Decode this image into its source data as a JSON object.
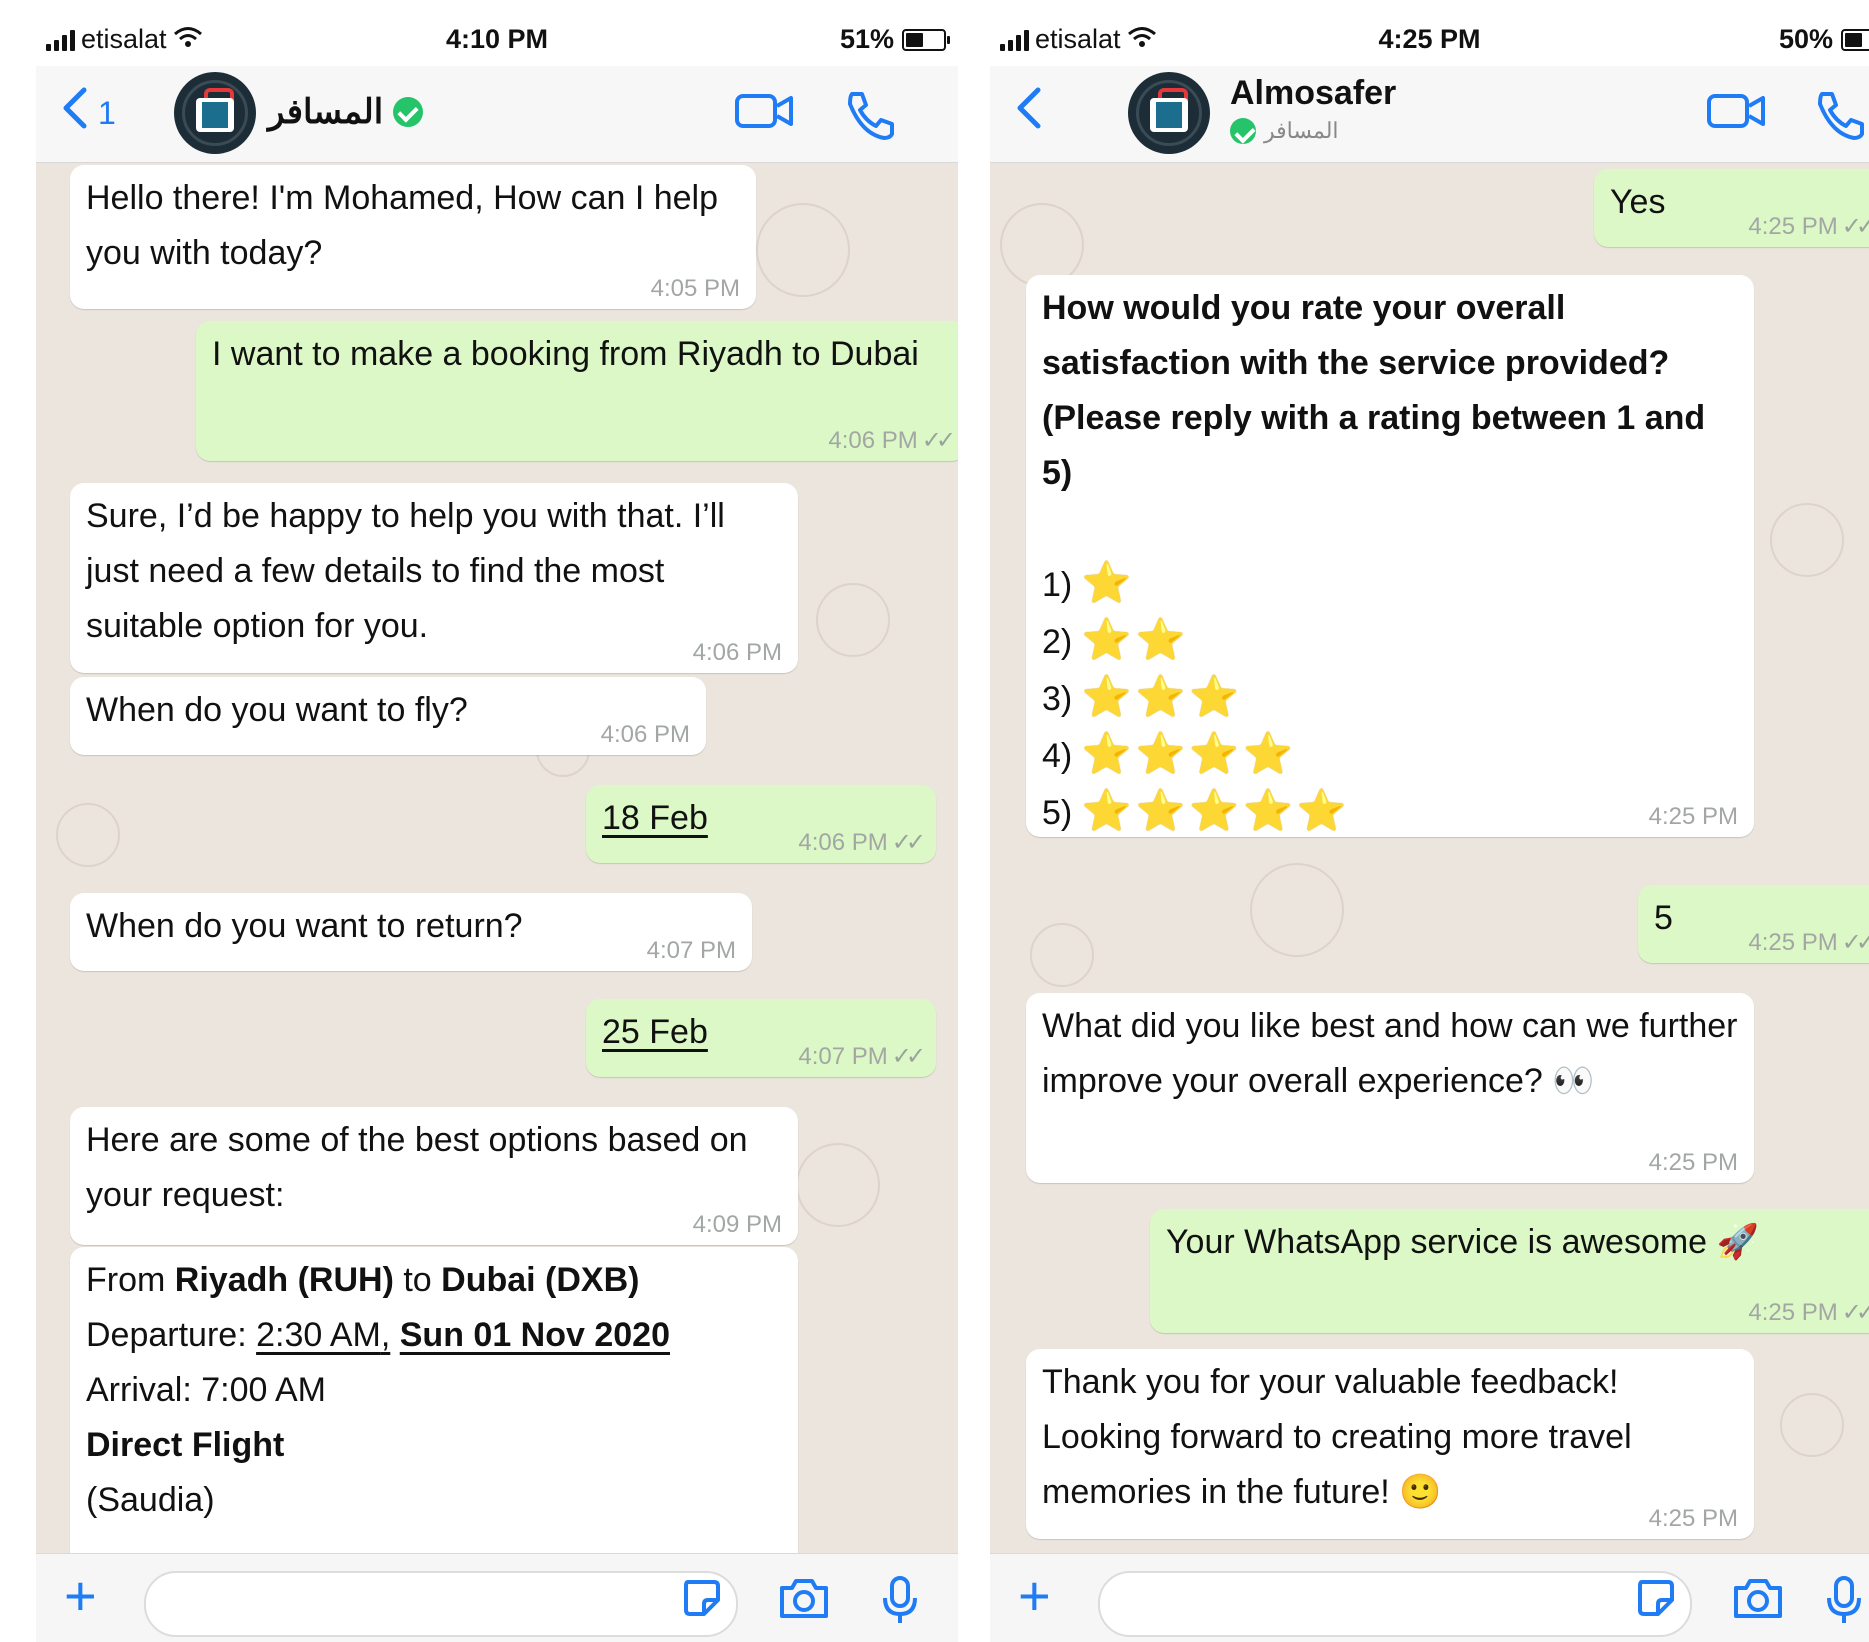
{
  "colors": {
    "accent": "#1f7cf5",
    "incoming_bubble": "#ffffff",
    "outgoing_bubble": "#dcf8c6",
    "chat_background": "#ece5dd",
    "verified_badge": "#25c46a",
    "star": "#ffc928"
  },
  "left": {
    "status": {
      "carrier": "etisalat",
      "time": "4:10 PM",
      "battery": "51%",
      "battery_level": 0.51
    },
    "header": {
      "back_count": "1",
      "contact_name": "المسافر",
      "icons": [
        "back-chevron-icon",
        "video-call-icon",
        "phone-call-icon"
      ]
    },
    "messages": [
      {
        "dir": "in",
        "text": "Hello there! I'm Mohamed, How can I help you with today?",
        "time": "4:05 PM"
      },
      {
        "dir": "out",
        "text": "I want to make a booking from Riyadh to Dubai",
        "time": "4:06 PM"
      },
      {
        "dir": "in",
        "text": "Sure, I’d be happy to help you with that. I’ll just need a few details to find the most suitable option for you.",
        "time": "4:06 PM"
      },
      {
        "dir": "in",
        "text": "When do you want to fly?",
        "time": "4:06 PM"
      },
      {
        "dir": "out",
        "text": "18 Feb",
        "time": "4:06 PM"
      },
      {
        "dir": "in",
        "text": "When do you want to return?",
        "time": "4:07 PM"
      },
      {
        "dir": "out",
        "text": "25 Feb",
        "time": "4:07 PM"
      },
      {
        "dir": "in",
        "text": "Here are some of the best options based on your request:",
        "time": "4:09 PM"
      }
    ],
    "flight_card": {
      "from_word": "From",
      "origin": "Riyadh (RUH)",
      "to_word": "to",
      "destination": "Dubai (DXB)",
      "departure_label": "Departure:",
      "departure_time": "2:30 AM",
      "departure_comma": ",",
      "departure_date": "Sun 01 Nov 2020",
      "arrival": "Arrival: 7:00 AM",
      "flight_type": "Direct Flight",
      "airline": "(Saudia)"
    },
    "input_icons": [
      "plus-icon",
      "sticker-icon",
      "camera-icon",
      "microphone-icon"
    ]
  },
  "right": {
    "status": {
      "carrier": "etisalat",
      "time": "4:25 PM",
      "battery": "50%",
      "battery_level": 0.5
    },
    "header": {
      "contact_name": "Almosafer",
      "subtitle": "المسافر",
      "icons": [
        "back-chevron-icon",
        "video-call-icon",
        "phone-call-icon"
      ]
    },
    "messages": {
      "yes": {
        "text": "Yes",
        "time": "4:25 PM"
      },
      "rating_question": {
        "text": "How would you rate your overall satisfaction with the service provided? (Please reply with a rating between 1 and 5)",
        "options": [
          {
            "label": "1)",
            "stars": "⭐",
            "count": 1
          },
          {
            "label": "2)",
            "stars": "⭐⭐",
            "count": 2
          },
          {
            "label": "3)",
            "stars": "⭐⭐⭐",
            "count": 3
          },
          {
            "label": "4)",
            "stars": "⭐⭐⭐⭐",
            "count": 4
          },
          {
            "label": "5)",
            "stars": "⭐⭐⭐⭐⭐",
            "count": 5
          }
        ],
        "time": "4:25 PM"
      },
      "rating_reply": {
        "text": "5",
        "time": "4:25 PM"
      },
      "improve_question": {
        "text": "What did you like best and how can we further improve your overall experience? 👀",
        "time": "4:25 PM"
      },
      "feedback": {
        "text": "Your WhatsApp service is awesome 🚀",
        "time": "4:25 PM"
      },
      "thanks": {
        "text": "Thank you for your valuable feedback! Looking forward to creating more travel memories in the future! 🙂",
        "time": "4:25 PM"
      }
    },
    "input_icons": [
      "plus-icon",
      "sticker-icon",
      "camera-icon",
      "microphone-icon"
    ]
  }
}
